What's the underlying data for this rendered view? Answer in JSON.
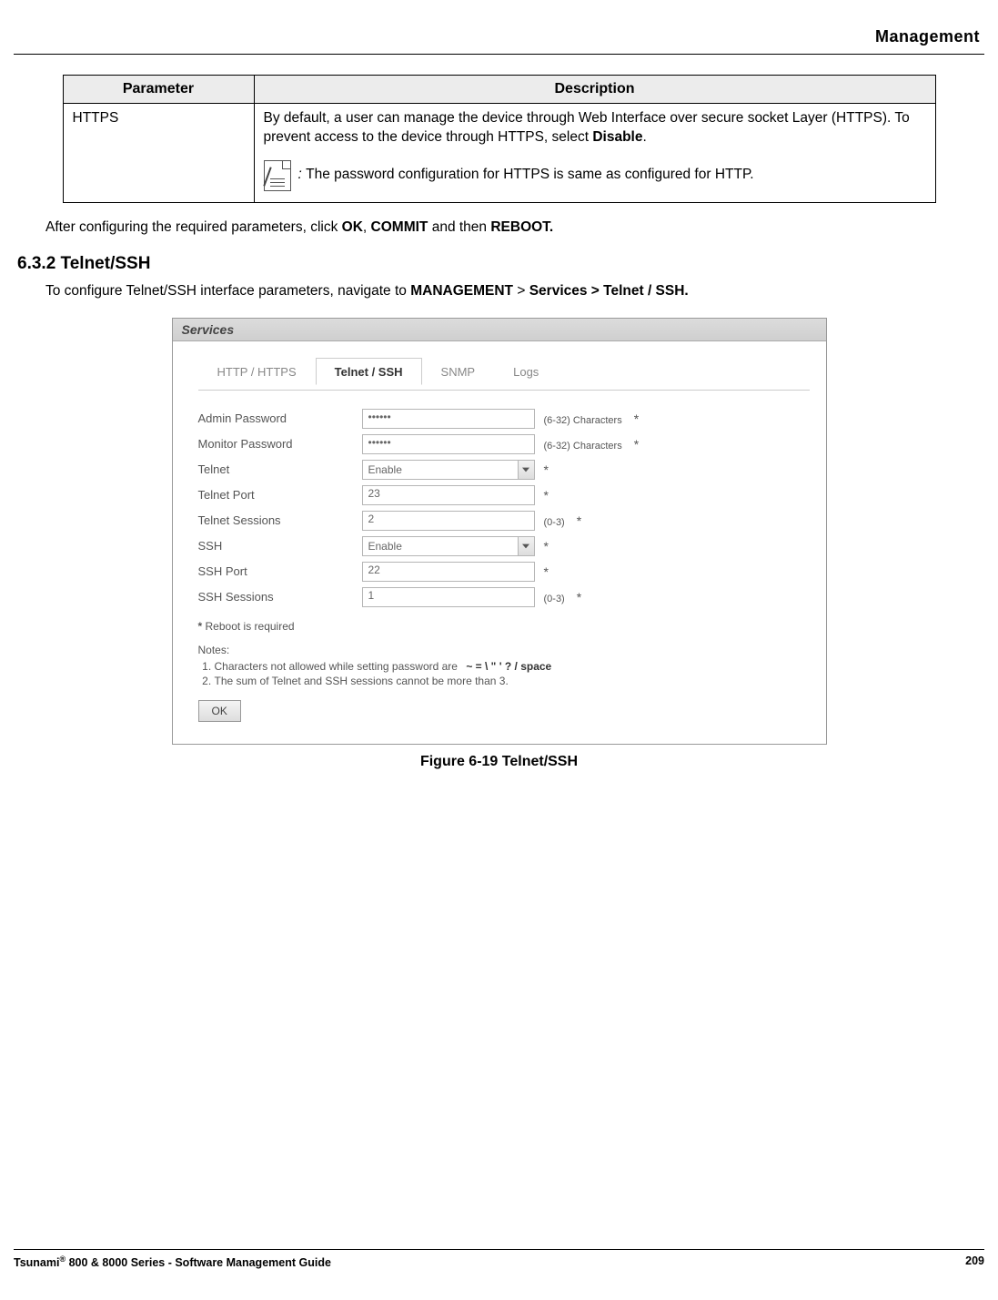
{
  "header": {
    "section": "Management"
  },
  "table": {
    "col_param": "Parameter",
    "col_desc": "Description",
    "row1": {
      "param": "HTTPS",
      "desc1": "By default, a user can manage the device through Web Interface over secure socket Layer (HTTPS). To prevent access to the device through HTTPS, select ",
      "desc1_bold": "Disable",
      "desc1_end": ".",
      "note_prefix": ": ",
      "note": "The password configuration for HTTPS is same as configured for HTTP."
    }
  },
  "after_text": {
    "t1": "After configuring the required parameters, click ",
    "b1": "OK",
    "t2": ", ",
    "b2": "COMMIT",
    "t3": " and then ",
    "b3": "REBOOT."
  },
  "section": {
    "heading": "6.3.2 Telnet/SSH",
    "intro1": "To configure Telnet/SSH interface parameters, navigate to ",
    "b1": "MANAGEMENT",
    "intro2": " > ",
    "b2": "Services > Telnet / SSH."
  },
  "panel": {
    "title": "Services",
    "tabs": {
      "t0": "HTTP / HTTPS",
      "t1": "Telnet / SSH",
      "t2": "SNMP",
      "t3": "Logs"
    },
    "fields": {
      "admin_pw": {
        "label": "Admin Password",
        "value": "••••••",
        "hint": "(6-32) Characters"
      },
      "monitor_pw": {
        "label": "Monitor Password",
        "value": "••••••",
        "hint": "(6-32) Characters"
      },
      "telnet": {
        "label": "Telnet",
        "value": "Enable"
      },
      "telnet_port": {
        "label": "Telnet Port",
        "value": "23"
      },
      "telnet_sessions": {
        "label": "Telnet Sessions",
        "value": "2",
        "hint": "(0-3)"
      },
      "ssh": {
        "label": "SSH",
        "value": "Enable"
      },
      "ssh_port": {
        "label": "SSH Port",
        "value": "22"
      },
      "ssh_sessions": {
        "label": "SSH Sessions",
        "value": "1",
        "hint": "(0-3)"
      }
    },
    "reboot_note_star": "*",
    "reboot_note": " Reboot is required",
    "notes_title": "Notes:",
    "note1_a": "Characters not allowed while setting password are ",
    "note1_b": "~  =  \\  \"  '  ? / space",
    "note2": "The sum of Telnet and SSH sessions cannot be more than 3.",
    "ok": "OK"
  },
  "caption": "Figure 6-19 Telnet/SSH",
  "footer": {
    "left1": "Tsunami",
    "left_sup": "®",
    "left2": " 800 & 8000 Series - Software Management Guide",
    "page": "209"
  }
}
